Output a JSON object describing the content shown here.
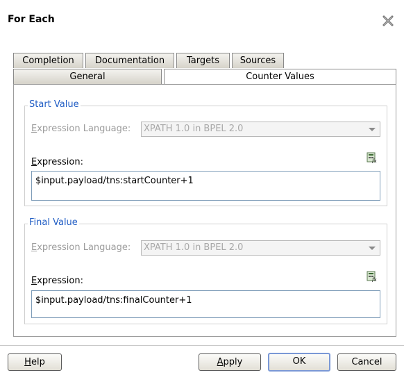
{
  "dialog": {
    "title": "For Each",
    "close_icon": "close-icon"
  },
  "tabs": {
    "back_row": [
      "Completion",
      "Documentation",
      "Targets",
      "Sources"
    ],
    "front_row": [
      "General",
      "Counter Values"
    ],
    "active": "Counter Values"
  },
  "start_value": {
    "legend": "Start Value",
    "language_label": "Expression Language:",
    "language_value": "XPATH 1.0 in BPEL 2.0",
    "expression_label": "Expression:",
    "expression_value": "$input.payload/tns:startCounter+1"
  },
  "final_value": {
    "legend": "Final Value",
    "language_label": "Expression Language:",
    "language_value": "XPATH 1.0 in BPEL 2.0",
    "expression_label": "Expression:",
    "expression_value": "$input.payload/tns:finalCounter+1"
  },
  "buttons": {
    "help": "Help",
    "apply": "Apply",
    "ok": "OK",
    "cancel": "Cancel"
  },
  "colors": {
    "legend": "#1f5cc4",
    "default_button_border": "#7a98d6"
  }
}
